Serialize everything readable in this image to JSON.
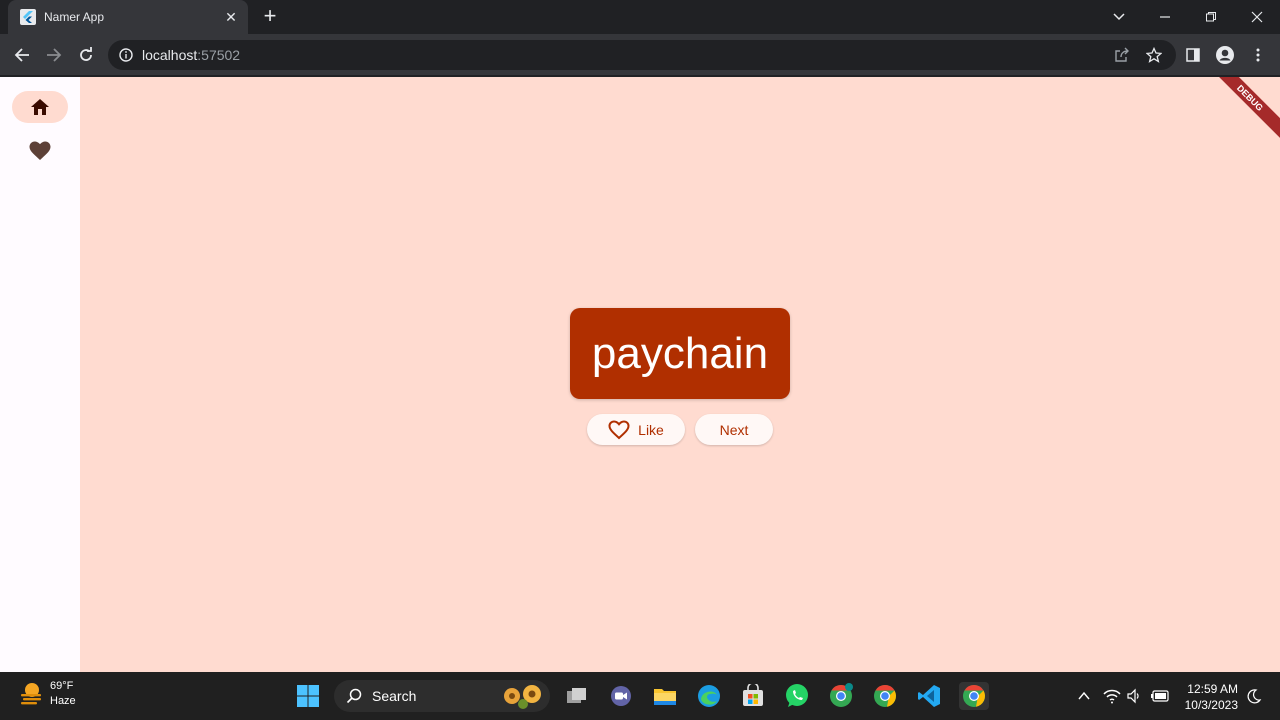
{
  "browser": {
    "tab_title": "Namer App",
    "close_symbol": "✕",
    "new_tab_symbol": "+",
    "url_host": "localhost",
    "url_port": ":57502",
    "window_controls": {
      "tab_search": "⌄",
      "minimize": "—",
      "restore": "❐",
      "close": "✕"
    }
  },
  "app": {
    "debug_banner": "DEBUG",
    "nav_items": [
      {
        "label": "Home",
        "icon": "home-icon",
        "selected": true
      },
      {
        "label": "Favorites",
        "icon": "heart-icon",
        "selected": false
      }
    ],
    "word_pair": "paychain",
    "like_label": "Like",
    "next_label": "Next",
    "colors": {
      "background": "#ffdbd0",
      "card": "#b02f00",
      "rail": "#fffbff",
      "button_text": "#b02f00"
    }
  },
  "taskbar": {
    "weather_temp": "69°F",
    "weather_condition": "Haze",
    "search_placeholder": "Search",
    "time": "12:59 AM",
    "date": "10/3/2023"
  }
}
